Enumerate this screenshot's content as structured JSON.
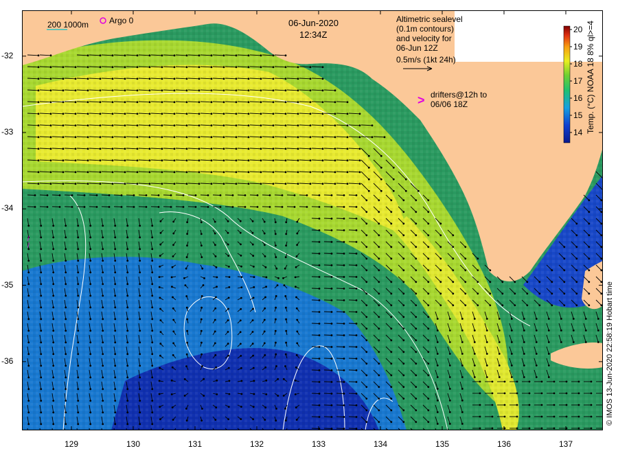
{
  "header": {
    "date": "06-Jun-2020",
    "time": "12:34Z"
  },
  "scale_legend": {
    "depths": "200  1000m",
    "argo": "Argo 0",
    "argo_color": "#e000e0",
    "depth_line_color": "#30c0c0"
  },
  "info_box": {
    "lines": [
      "Altimetric sealevel",
      "(0.1m contours)",
      "and velocity for",
      "06-Jun 12Z",
      "0.5m/s (1kt 24h)"
    ]
  },
  "drifters": {
    "lines": [
      "drifters@12h to",
      "06/06 18Z"
    ],
    "symbol": ">",
    "color": "#e000e0"
  },
  "colorbar": {
    "title": "Temp. (°C) NOAA 18 8% ql>=4",
    "ticks": [
      "20",
      "19",
      "18",
      "17",
      "16",
      "15",
      "14"
    ],
    "min": 13.4,
    "max": 20.2
  },
  "axes": {
    "x_ticks": [
      "129",
      "130",
      "131",
      "132",
      "133",
      "134",
      "135",
      "136",
      "137"
    ],
    "y_ticks": [
      "-32",
      "-33",
      "-34",
      "-35",
      "-36"
    ],
    "x_range": [
      128.2,
      137.6
    ],
    "y_range": [
      -36.9,
      -31.4
    ]
  },
  "credit": "© IMOS 13-Jun-2020 22:58:19 Hobart time",
  "colors": {
    "land": "#fbc898",
    "arrow": "#000000",
    "contour": "#ffffff"
  }
}
